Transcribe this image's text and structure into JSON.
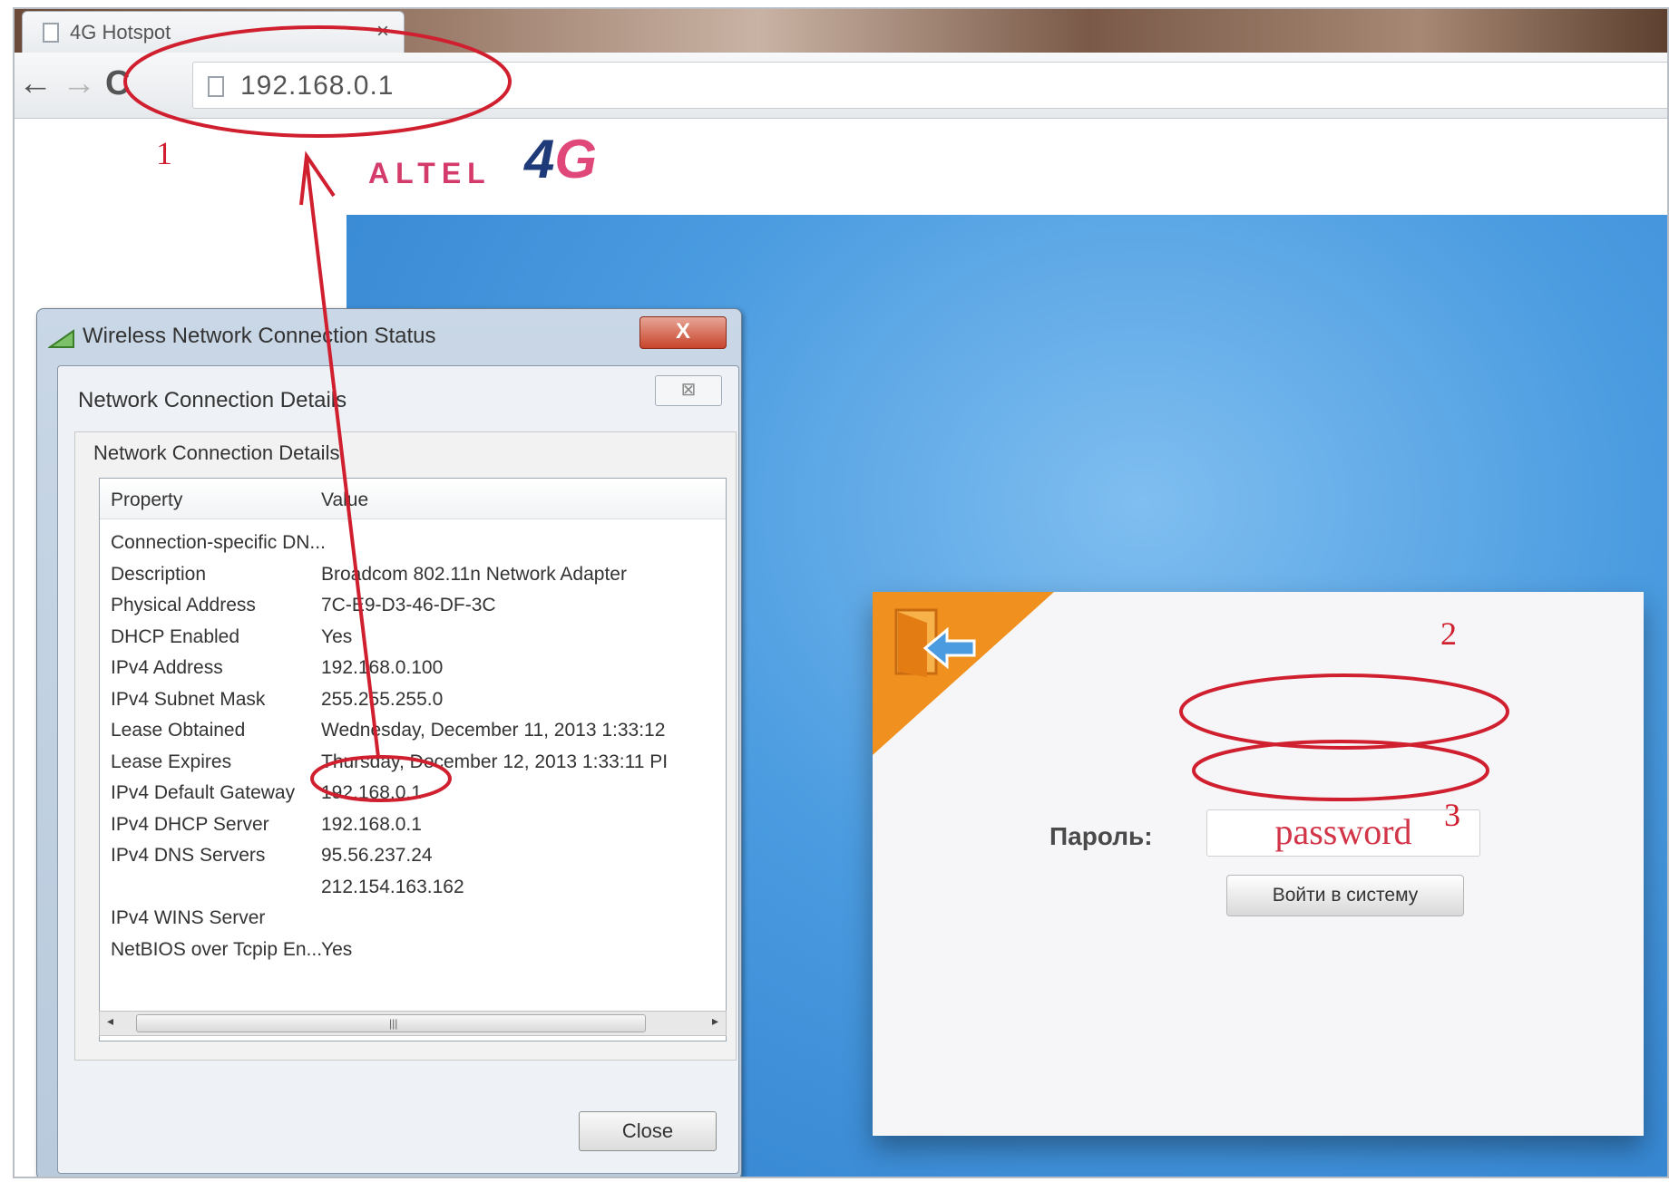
{
  "browser": {
    "tab_title": "4G Hotspot",
    "tab_close": "×",
    "url": "192.168.0.1",
    "nav_back": "←",
    "nav_forward": "→",
    "nav_reload": "C"
  },
  "site": {
    "brand_word": "ALTEL",
    "brand_4": "4",
    "brand_g": "G",
    "password_label": "Пароль:",
    "password_value": "password",
    "login_button": "Войти в систему"
  },
  "dialog": {
    "window_title": "Wireless Network Connection Status",
    "window_close": "X",
    "inner_title": "Network Connection Details",
    "inner_close": "⊠",
    "group_title": "Network Connection Details",
    "col_property": "Property",
    "col_value": "Value",
    "rows": [
      {
        "property": "Connection-specific DN...",
        "value": ""
      },
      {
        "property": "Description",
        "value": "Broadcom 802.11n Network Adapter"
      },
      {
        "property": "Physical Address",
        "value": "7C-E9-D3-46-DF-3C"
      },
      {
        "property": "DHCP Enabled",
        "value": "Yes"
      },
      {
        "property": "IPv4 Address",
        "value": "192.168.0.100"
      },
      {
        "property": "IPv4 Subnet Mask",
        "value": "255.255.255.0"
      },
      {
        "property": "Lease Obtained",
        "value": "Wednesday, December 11, 2013 1:33:12"
      },
      {
        "property": "Lease Expires",
        "value": "Thursday, December 12, 2013 1:33:11 PI"
      },
      {
        "property": "IPv4 Default Gateway",
        "value": "192.168.0.1"
      },
      {
        "property": "IPv4 DHCP Server",
        "value": "192.168.0.1"
      },
      {
        "property": "IPv4 DNS Servers",
        "value": "95.56.237.24"
      },
      {
        "property": "",
        "value": "212.154.163.162"
      },
      {
        "property": "IPv4 WINS Server",
        "value": ""
      },
      {
        "property": "NetBIOS over Tcpip En...",
        "value": "Yes"
      }
    ],
    "scroll_left": "◂",
    "scroll_right": "▸",
    "scroll_grip": "|||",
    "close_button": "Close"
  },
  "annotations": {
    "step1": "1",
    "step2": "2",
    "step3": "3",
    "color": "#d0202f"
  },
  "colors": {
    "page_blue": "#4a9be0",
    "corner_orange": "#f0901f",
    "brand_pink": "#d43a6a",
    "brand_navy": "#1e3a78"
  }
}
